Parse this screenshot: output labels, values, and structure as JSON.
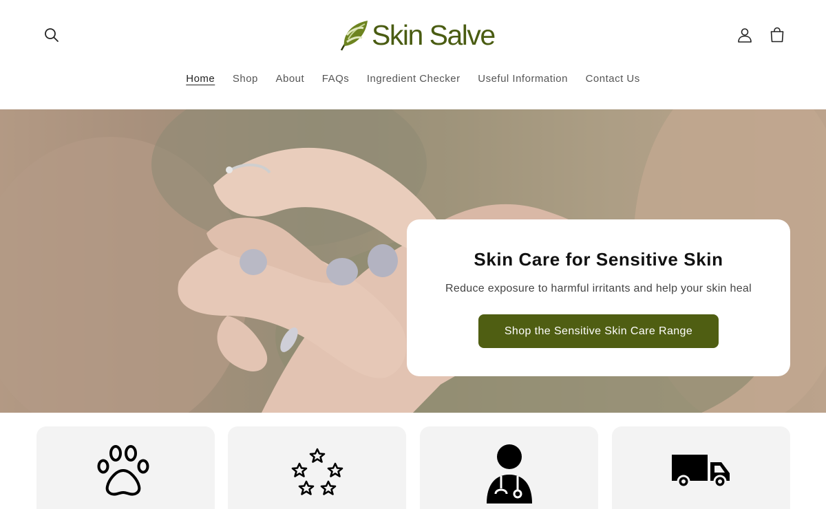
{
  "brand": {
    "name": "Skin Salve",
    "color": "#4a5c12"
  },
  "header": {
    "icons": [
      "search-icon",
      "account-icon",
      "cart-icon"
    ]
  },
  "nav": {
    "items": [
      {
        "label": "Home",
        "active": true
      },
      {
        "label": "Shop",
        "active": false
      },
      {
        "label": "About",
        "active": false
      },
      {
        "label": "FAQs",
        "active": false
      },
      {
        "label": "Ingredient Checker",
        "active": false
      },
      {
        "label": "Useful Information",
        "active": false
      },
      {
        "label": "Contact Us",
        "active": false
      }
    ]
  },
  "hero": {
    "title": "Skin Care for Sensitive Skin",
    "subtitle": "Reduce exposure to harmful irritants and help your skin heal",
    "cta_label": "Shop the Sensitive Skin Care Range",
    "cta_color": "#4f5e12",
    "image_icon": "hands-applying-cream-photo"
  },
  "features": {
    "icons": [
      "paw-icon",
      "stars-icon",
      "doctor-icon",
      "delivery-truck-icon"
    ]
  }
}
